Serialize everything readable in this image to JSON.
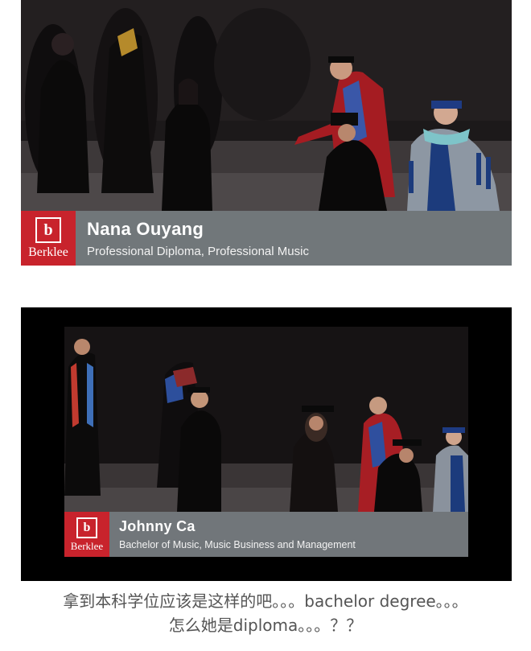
{
  "frames": [
    {
      "graduate_name": "Nana Ouyang",
      "degree": "Professional Diploma, Professional Music",
      "logo_text": "Berklee"
    },
    {
      "graduate_name": "Johnny Ca",
      "degree": "Bachelor of Music, Music Business and Management",
      "logo_text": "Berklee"
    }
  ],
  "comment": {
    "line1": "拿到本科学位应该是这样的吧。。。bachelor degree。。。",
    "line2": "怎么她是diploma。。。？？"
  },
  "colors": {
    "brand_red": "#c8232c",
    "caption_gray": "#767c80",
    "comment_text": "#555555"
  },
  "icons": [
    "berklee-logo-icon"
  ]
}
